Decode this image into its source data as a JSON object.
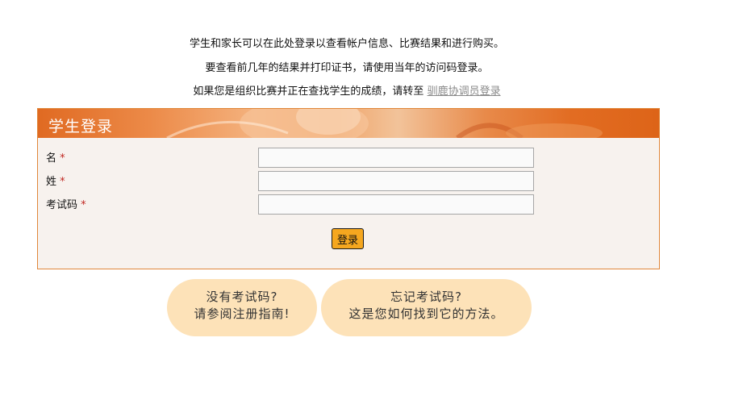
{
  "intro": {
    "line1": "学生和家长可以在此处登录以查看帐户信息、比赛结果和进行购买。",
    "line2": "要查看前几年的结果并打印证书，请使用当年的访问码登录。",
    "line3_prefix": "如果您是组织比赛并正在查找学生的成绩，请转至 ",
    "line3_link": "驯鹿协调员登录"
  },
  "panel": {
    "title": "学生登录",
    "required_mark": "*",
    "fields": [
      {
        "label": "名",
        "value": ""
      },
      {
        "label": "姓",
        "value": ""
      },
      {
        "label": "考试码",
        "value": ""
      }
    ],
    "submit_label": "登录"
  },
  "help": {
    "left_line1": "没有考试码?",
    "left_line2": "请参阅注册指南!",
    "right_line1": "忘记考试码?",
    "right_line2": "这是您如何找到它的方法。"
  },
  "colors": {
    "accent": "#e06a22",
    "button": "#f5a71f",
    "pill": "#fde2b8",
    "required": "#c0261f",
    "panel_bg": "#f7f2ee"
  }
}
